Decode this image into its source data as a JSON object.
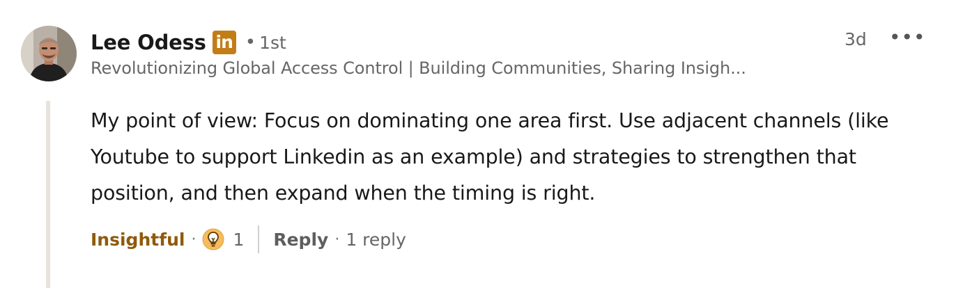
{
  "comment": {
    "author": {
      "name": "Lee Odess",
      "badge": "in",
      "degree_separator": "•",
      "degree": "1st",
      "headline": "Revolutionizing Global Access Control | Building Communities, Sharing Insigh..."
    },
    "timestamp": "3d",
    "more_label": "•••",
    "text": "My point of view: Focus on dominating one area first. Use adjacent channels (like Youtube to support Linkedin as an example) and strategies to strengthen that position, and then expand when the timing is right.",
    "actions": {
      "reaction_label": "Insightful",
      "separator": "·",
      "reaction_icon": "lightbulb-icon",
      "reaction_count": "1",
      "reply_label": "Reply",
      "reply_count_label": "1 reply"
    },
    "colors": {
      "badge": "#c37d16",
      "reaction_label": "#8f5a0c",
      "reaction_icon_bg": "#f5bb5c",
      "thread_line": "#e8e3dc"
    }
  }
}
